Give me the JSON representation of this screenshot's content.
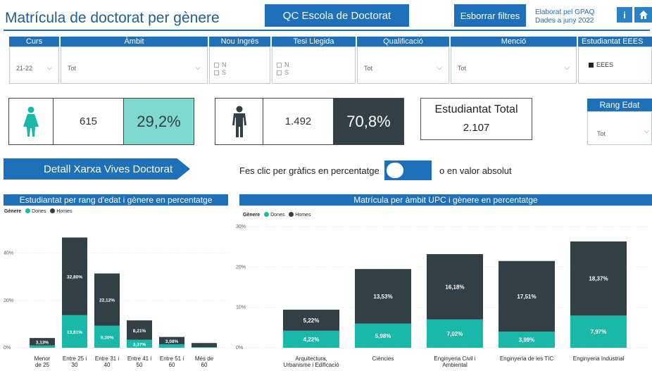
{
  "header": {
    "title": "Matrícula de doctorat per gènere",
    "qc_button": "QC Escola de Doctorat",
    "clear_button": "Esborrar filtres",
    "credits_line1": "Elaborat pel GPAQ",
    "credits_line2": "Dades a juny 2022",
    "info_icon": "i",
    "home_icon": "home-icon"
  },
  "filters": {
    "curs": {
      "label": "Curs",
      "value": "21-22"
    },
    "ambit": {
      "label": "Àmbit",
      "value": "Tot"
    },
    "nou_ingres": {
      "label": "Nou Ingrés",
      "options": [
        "N",
        "S"
      ]
    },
    "tesi_llegida": {
      "label": "Tesi Llegida",
      "options": [
        "N",
        "S"
      ]
    },
    "qualificacio": {
      "label": "Qualificació",
      "value": "Tot"
    },
    "mencio": {
      "label": "Menció",
      "value": "Tot"
    },
    "eees": {
      "label": "Estudiantat EEES",
      "option": "EEES"
    },
    "rang_edat": {
      "label": "Rang Edat",
      "value": "Tot"
    }
  },
  "kpis": {
    "women": {
      "count": "615",
      "pct": "29,2%",
      "color": "#7fd9cf"
    },
    "men": {
      "count": "1.492",
      "pct": "70,8%",
      "color": "#333f47"
    },
    "total": {
      "label": "Estudiantat Total",
      "value": "2.107"
    }
  },
  "detail_button": "Detall Xarxa Vives Doctorat",
  "toggle": {
    "pre_label": "Fes clic per gràfics en percentatge",
    "post_label": "o en valor absolut"
  },
  "colors": {
    "dones": "#1ab8a8",
    "homes": "#333f47",
    "accent": "#1e70b8"
  },
  "chart_data": [
    {
      "type": "bar",
      "stacked": true,
      "title": "Estudiantat per rang d'edat i gènere en percentatge",
      "legend_title": "Gènere",
      "categories": [
        "Menor de 25",
        "Entre 25 i 30",
        "Entre 31 i 40",
        "Entre 41 i 50",
        "Entre 51 i 60",
        "Més de 60"
      ],
      "category_lines": [
        [
          "Menor",
          "de 25"
        ],
        [
          "Entre 25 i",
          "30"
        ],
        [
          "Entre 31 i",
          "40"
        ],
        [
          "Entre 41 i",
          "50"
        ],
        [
          "Entre 51 i",
          "60"
        ],
        [
          "Més de",
          "60"
        ]
      ],
      "series": [
        {
          "name": "Dones",
          "values": [
            1.0,
            13.81,
            9.3,
            3.37,
            1.5,
            0.3
          ],
          "labels": [
            "",
            "13,81%",
            "9,30%",
            "3,37%",
            "",
            ""
          ]
        },
        {
          "name": "Homes",
          "values": [
            3.13,
            32.8,
            22.12,
            8.21,
            3.08,
            1.7
          ],
          "labels": [
            "3,13%",
            "32,80%",
            "22,12%",
            "8,21%",
            "3,08%",
            ""
          ]
        }
      ],
      "yticks": [
        0,
        20,
        40
      ],
      "ytick_labels": [
        "0%",
        "20%",
        "40%"
      ],
      "ylim": [
        0,
        50
      ],
      "legend_position": "top-left"
    },
    {
      "type": "bar",
      "stacked": true,
      "title": "Matrícula per àmbit UPC i gènere en percentatge",
      "legend_title": "Gènere",
      "categories": [
        "Arquitectura, Urbanisme i Edificació",
        "Ciències",
        "Enginyeria Civil i Ambiental",
        "Enginyeria de les TIC",
        "Enginyeria Industrial"
      ],
      "category_lines": [
        [
          "Arquitectura,",
          "Urbanisme i Edificació"
        ],
        [
          "Ciències"
        ],
        [
          "Enginyeria Civil i",
          "Ambiental"
        ],
        [
          "Enginyeria de les TIC"
        ],
        [
          "Enginyeria Industrial"
        ]
      ],
      "series": [
        {
          "name": "Dones",
          "values": [
            4.22,
            5.98,
            7.02,
            3.99,
            7.97
          ],
          "labels": [
            "4,22%",
            "5,98%",
            "7,02%",
            "3,99%",
            "7,97%"
          ]
        },
        {
          "name": "Homes",
          "values": [
            5.22,
            13.53,
            16.18,
            17.51,
            18.37
          ],
          "labels": [
            "5,22%",
            "13,53%",
            "16,18%",
            "17,51%",
            "18,37%"
          ]
        }
      ],
      "yticks": [
        0,
        10,
        20,
        30
      ],
      "ytick_labels": [
        "0%",
        "10%",
        "20%",
        "30%"
      ],
      "ylim": [
        0,
        30
      ],
      "legend_position": "top-left"
    }
  ]
}
